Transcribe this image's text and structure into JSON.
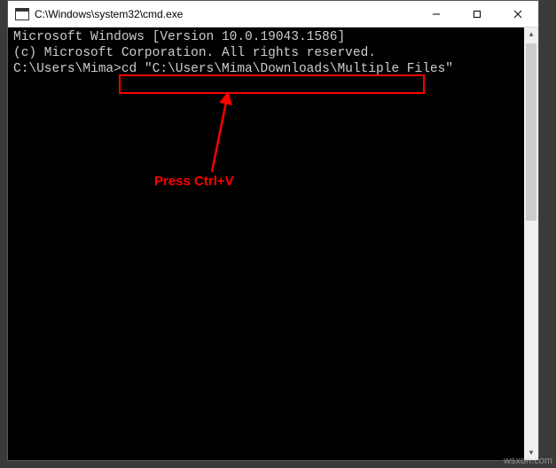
{
  "titlebar": {
    "title": "C:\\Windows\\system32\\cmd.exe"
  },
  "terminal": {
    "line1": "Microsoft Windows [Version 10.0.19043.1586]",
    "line2": "(c) Microsoft Corporation. All rights reserved.",
    "blank": "",
    "prompt_prefix": "C:\\Users\\Mima>",
    "prompt_cmd": "cd ",
    "prompt_path": "\"C:\\Users\\Mima\\Downloads\\Multiple Files\""
  },
  "annotation": {
    "label": "Press Ctrl+V"
  },
  "watermark": "wsxdn.com",
  "colors": {
    "highlight": "#ff0000",
    "terminal_bg": "#000000",
    "terminal_fg": "#cccccc"
  }
}
